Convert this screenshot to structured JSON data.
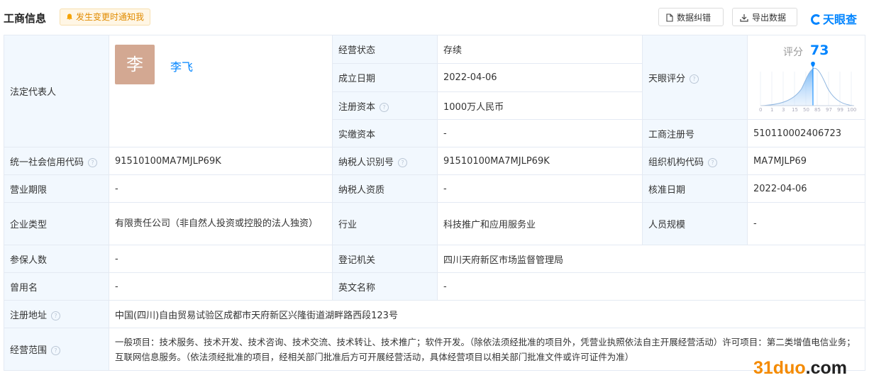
{
  "header": {
    "title": "工商信息",
    "notify_label": "发生变更时通知我",
    "report_error_label": "数据纠错",
    "export_label": "导出数据",
    "logo_text": "天眼查"
  },
  "legal_rep": {
    "label": "法定代表人",
    "avatar_char": "李",
    "name": "李飞"
  },
  "fields": {
    "status_label": "经营状态",
    "status_value": "存续",
    "founded_label": "成立日期",
    "founded_value": "2022-04-06",
    "reg_capital_label": "注册资本",
    "reg_capital_value": "1000万人民币",
    "paid_capital_label": "实缴资本",
    "paid_capital_value": "-",
    "score_label": "天眼评分",
    "reg_no_label": "工商注册号",
    "reg_no_value": "510110002406723",
    "credit_code_label": "统一社会信用代码",
    "credit_code_value": "91510100MA7MJLP69K",
    "taxpayer_id_label": "纳税人识别号",
    "taxpayer_id_value": "91510100MA7MJLP69K",
    "org_code_label": "组织机构代码",
    "org_code_value": "MA7MJLP69",
    "term_label": "营业期限",
    "term_value": "-",
    "taxpayer_qual_label": "纳税人资质",
    "taxpayer_qual_value": "-",
    "approved_label": "核准日期",
    "approved_value": "2022-04-06",
    "type_label": "企业类型",
    "type_value": "有限责任公司（非自然人投资或控股的法人独资）",
    "industry_label": "行业",
    "industry_value": "科技推广和应用服务业",
    "staff_label": "人员规模",
    "staff_value": "-",
    "insured_label": "参保人数",
    "insured_value": "-",
    "authority_label": "登记机关",
    "authority_value": "四川天府新区市场监督管理局",
    "former_name_label": "曾用名",
    "former_name_value": "-",
    "english_label": "英文名称",
    "english_value": "-",
    "address_label": "注册地址",
    "address_value": "中国(四川)自由贸易试验区成都市天府新区兴隆街道湖畔路西段123号",
    "scope_label": "经营范围",
    "scope_value": "一般项目：技术服务、技术开发、技术咨询、技术交流、技术转让、技术推广；软件开发。（除依法须经批准的项目外，凭营业执照依法自主开展经营活动）许可项目：第二类增值电信业务；互联网信息服务。（依法须经批准的项目，经相关部门批准后方可开展经营活动，具体经营项目以相关部门批准文件或许可证件为准）"
  },
  "score": {
    "label": "评分",
    "value": "73",
    "axis_ticks": [
      "0",
      "1",
      "3",
      "15",
      "50",
      "85",
      "97",
      "99",
      "100"
    ],
    "accent": "#0084ff"
  },
  "watermark": {
    "part1": "31duo",
    "part2": ".com"
  }
}
